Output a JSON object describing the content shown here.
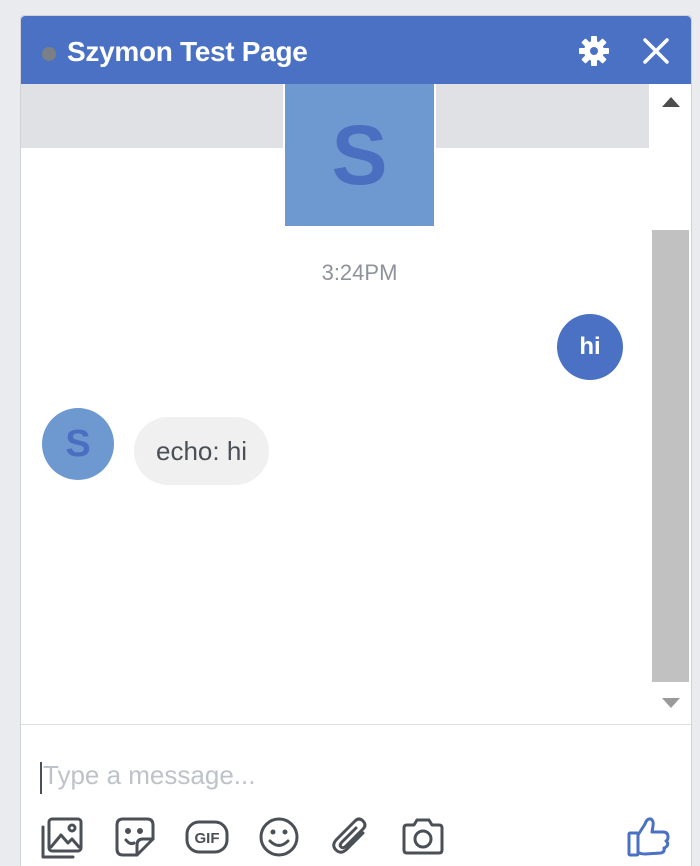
{
  "header": {
    "title": "Szymon Test Page",
    "status": "offline",
    "icons": [
      "gear-icon",
      "close-icon"
    ]
  },
  "page_avatar": {
    "letter": "S"
  },
  "conversation": {
    "timestamp": "3:24PM",
    "messages": [
      {
        "direction": "outgoing",
        "text": "hi"
      },
      {
        "direction": "incoming",
        "sender_initial": "S",
        "text": "echo: hi"
      }
    ]
  },
  "composer": {
    "placeholder": "Type a message...",
    "value": "",
    "tools": [
      "photo-icon",
      "sticker-icon",
      "gif-icon",
      "emoji-icon",
      "attachment-icon",
      "camera-icon",
      "like-icon"
    ],
    "gif_label": "GIF"
  },
  "colors": {
    "header": "#4a71c4",
    "accent": "#4a71c4",
    "avatar": "#6e98d0",
    "incoming_bubble": "#f1f0f0"
  }
}
